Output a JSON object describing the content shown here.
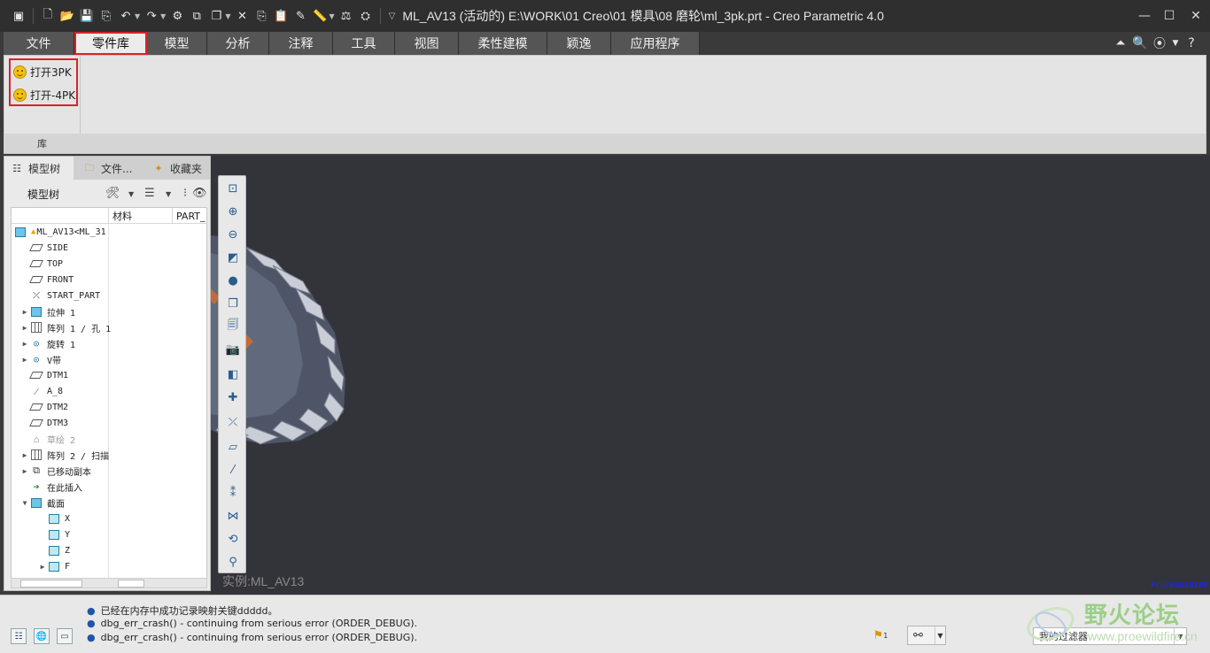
{
  "titlebar": {
    "title": "ML_AV13 (活动的) E:\\WORK\\01 Creo\\01 模具\\08 磨轮\\ml_3pk.prt - Creo Parametric 4.0"
  },
  "menu": {
    "tabs": [
      "文件",
      "零件库",
      "模型",
      "分析",
      "注释",
      "工具",
      "视图",
      "柔性建模",
      "颖逸",
      "应用程序"
    ],
    "active_tab": "零件库"
  },
  "ribbon": {
    "group_label": "库",
    "items": [
      {
        "label": "打开3PK",
        "icon": "smiley-icon"
      },
      {
        "label": "打开-4PK",
        "icon": "smiley-icon"
      }
    ]
  },
  "left_panel": {
    "tabs": [
      "模型树",
      "文件...",
      "收藏夹"
    ],
    "toolbar_title": "模型树",
    "columns": [
      "材料",
      "PART_"
    ],
    "tree": [
      {
        "label": "ML_AV13<ML_31",
        "icon": "part-icon",
        "expand": "",
        "indent": 0
      },
      {
        "label": "SIDE",
        "icon": "datum-plane-icon",
        "expand": "",
        "indent": 1
      },
      {
        "label": "TOP",
        "icon": "datum-plane-icon",
        "expand": "",
        "indent": 1
      },
      {
        "label": "FRONT",
        "icon": "datum-plane-icon",
        "expand": "",
        "indent": 1
      },
      {
        "label": "START_PART",
        "icon": "coordinate-system-icon",
        "expand": "",
        "indent": 1
      },
      {
        "label": "拉伸 1",
        "icon": "extrude-icon",
        "expand": "▶",
        "indent": 1
      },
      {
        "label": "阵列 1 / 孔 1",
        "icon": "pattern-icon",
        "expand": "▶",
        "indent": 1
      },
      {
        "label": "旋转 1",
        "icon": "revolve-icon",
        "expand": "▶",
        "indent": 1
      },
      {
        "label": "V带",
        "icon": "revolve-icon",
        "expand": "▶",
        "indent": 1
      },
      {
        "label": "DTM1",
        "icon": "datum-plane-icon",
        "expand": "",
        "indent": 1
      },
      {
        "label": "A_8",
        "icon": "axis-icon",
        "expand": "",
        "indent": 1
      },
      {
        "label": "DTM2",
        "icon": "datum-plane-icon",
        "expand": "",
        "indent": 1
      },
      {
        "label": "DTM3",
        "icon": "datum-plane-icon",
        "expand": "",
        "indent": 1
      },
      {
        "label": "草绘 2",
        "icon": "sketch-icon",
        "expand": "",
        "indent": 1,
        "dim": true
      },
      {
        "label": "阵列 2 / 扫描",
        "icon": "pattern-icon",
        "expand": "▶",
        "indent": 1
      },
      {
        "label": "已移动副本",
        "icon": "moved-copy-icon",
        "expand": "▶",
        "indent": 1
      },
      {
        "label": "在此插入",
        "icon": "insert-here-arrow-icon",
        "expand": "",
        "indent": 1
      },
      {
        "label": "截面",
        "icon": "section-icon",
        "expand": "▼",
        "indent": 1
      },
      {
        "label": "X",
        "icon": "section-plane-icon",
        "expand": "",
        "indent": 2
      },
      {
        "label": "Y",
        "icon": "section-plane-icon",
        "expand": "",
        "indent": 2
      },
      {
        "label": "Z",
        "icon": "section-plane-icon",
        "expand": "",
        "indent": 2
      },
      {
        "label": "F",
        "icon": "section-plane-icon",
        "expand": "▶",
        "indent": 2
      }
    ]
  },
  "graphics": {
    "instance_label": "实例:ML_AV13",
    "corner_text": "Pro/ENGINEER"
  },
  "status": {
    "messages": [
      "已经在内存中成功记录映射关键ddddd。",
      "dbg_err_crash() - continuing from serious error (ORDER_DEBUG).",
      "dbg_err_crash() - continuing from serious error (ORDER_DEBUG)."
    ],
    "filter_label": "我的过滤器",
    "flag_count": "1"
  },
  "watermark": {
    "title": "野火论坛",
    "url": "www.proewildfire.cn"
  }
}
